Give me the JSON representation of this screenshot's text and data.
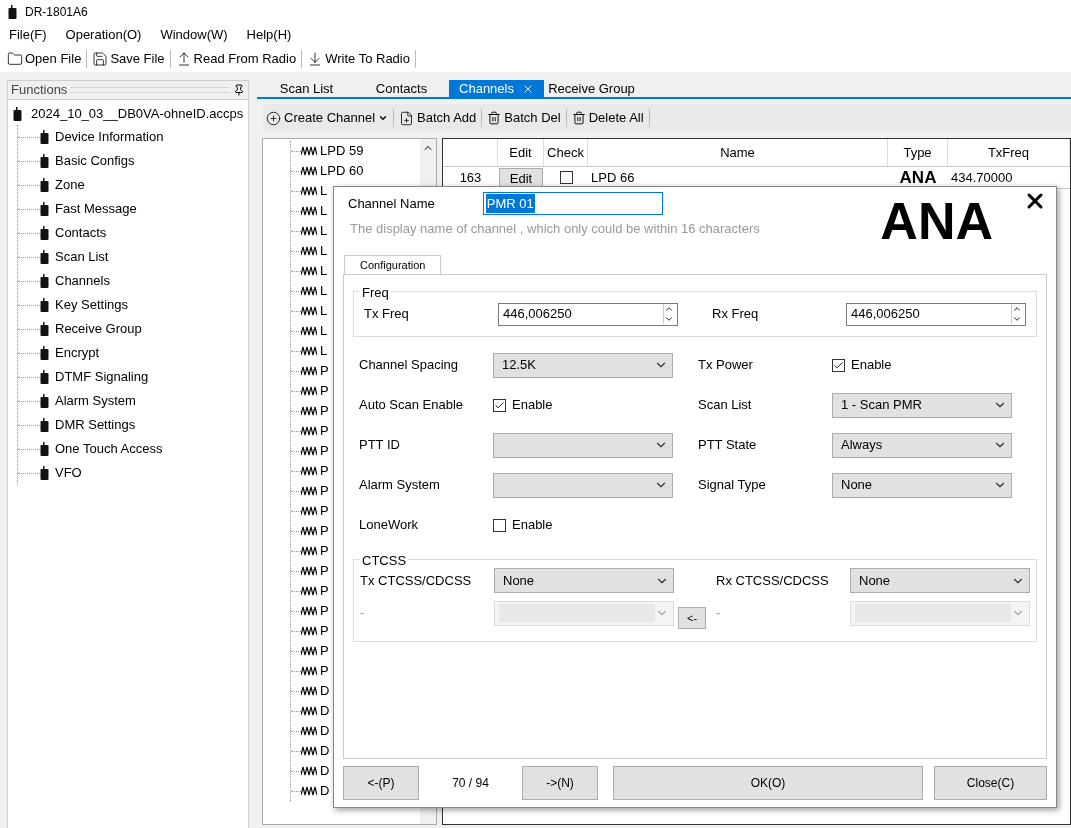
{
  "window": {
    "title": "DR-1801A6"
  },
  "menu": [
    "File(F)",
    "Operation(O)",
    "Window(W)",
    "Help(H)"
  ],
  "toolbar": [
    {
      "label": "Open File"
    },
    {
      "label": "Save File"
    },
    {
      "label": "Read From Radio"
    },
    {
      "label": "Write To Radio"
    }
  ],
  "functions": {
    "title": "Functions",
    "root": {
      "label": "2024_10_03__DB0VA-ohneID.accps",
      "children": [
        "Device Information",
        "Basic Configs",
        "Zone",
        "Fast Message",
        "Contacts",
        "Scan List",
        "Channels",
        "Key Settings",
        "Receive Group",
        "Encrypt",
        "DTMF Signaling",
        "Alarm System",
        "DMR Settings",
        "One Touch Access",
        "VFO"
      ]
    }
  },
  "tabs": [
    {
      "label": "Scan List",
      "selected": false,
      "closable": false
    },
    {
      "label": "Contacts",
      "selected": false,
      "closable": false
    },
    {
      "label": "Channels",
      "selected": true,
      "closable": true
    },
    {
      "label": "Receive Group",
      "selected": false,
      "closable": false
    }
  ],
  "channel_toolbar": [
    {
      "label": "Create Channel",
      "dropdown": true
    },
    {
      "label": "Batch Add",
      "dropdown": false
    },
    {
      "label": "Batch Del",
      "dropdown": false
    },
    {
      "label": "Delete All",
      "dropdown": false
    }
  ],
  "channel_tree": [
    "LPD 59",
    "LPD 60",
    "L",
    "L",
    "L",
    "L",
    "L",
    "L",
    "L",
    "L",
    "L",
    "P",
    "P",
    "P",
    "P",
    "P",
    "P",
    "P",
    "P",
    "P",
    "P",
    "P",
    "P",
    "P",
    "P",
    "P",
    "P",
    "D",
    "D",
    "D",
    "D",
    "D",
    "D"
  ],
  "table": {
    "columns": [
      "Edit",
      "Check",
      "Name",
      "Type",
      "TxFreq"
    ],
    "rows": [
      {
        "number": "163",
        "edit": "Edit",
        "checked": false,
        "name": "LPD 66",
        "type": "ANA",
        "tx_freq": "434.70000"
      }
    ]
  },
  "dialog": {
    "name_label": "Channel Name",
    "name_value": "PMR 01",
    "hint": "The display name of channel , which only could be within 16 characters",
    "badge": "ANA",
    "tab": "Configuration",
    "freq": {
      "title": "Freq",
      "tx": {
        "label": "Tx Freq",
        "value": "446,006250"
      },
      "rx": {
        "label": "Rx Freq",
        "value": "446,006250"
      }
    },
    "fields": [
      [
        {
          "label": "Channel Spacing",
          "kind": "select",
          "value": "12.5K"
        },
        {
          "label": "Tx Power",
          "kind": "checkbox",
          "text": "Enable",
          "checked": true
        }
      ],
      [
        {
          "label": "Auto Scan Enable",
          "kind": "checkbox",
          "text": "Enable",
          "checked": true
        },
        {
          "label": "Scan List",
          "kind": "select",
          "value": "1 - Scan PMR"
        }
      ],
      [
        {
          "label": "PTT ID",
          "kind": "select"
        },
        {
          "label": "PTT State",
          "kind": "select",
          "value": "Always"
        }
      ],
      [
        {
          "label": "Alarm System",
          "kind": "select"
        },
        {
          "label": "Signal Type",
          "kind": "select",
          "value": "None"
        }
      ],
      [
        {
          "label": "LoneWork",
          "kind": "checkbox",
          "text": "Enable",
          "checked": false
        }
      ]
    ],
    "ctcss": {
      "title": "CTCSS",
      "tx": {
        "label": "Tx CTCSS/CDCSS",
        "value": "None"
      },
      "rx": {
        "label": "Rx CTCSS/CDCSS",
        "value": "None"
      },
      "tx_sub": {
        "label": "-",
        "disabled": true
      },
      "rx_sub": {
        "label": "-",
        "disabled": true
      },
      "copy_button": "<-"
    },
    "footer": {
      "prev": "<-(P)",
      "counter": "70 / 94",
      "next": "->(N)",
      "ok": "OK(O)",
      "close": "Close(C)"
    }
  }
}
